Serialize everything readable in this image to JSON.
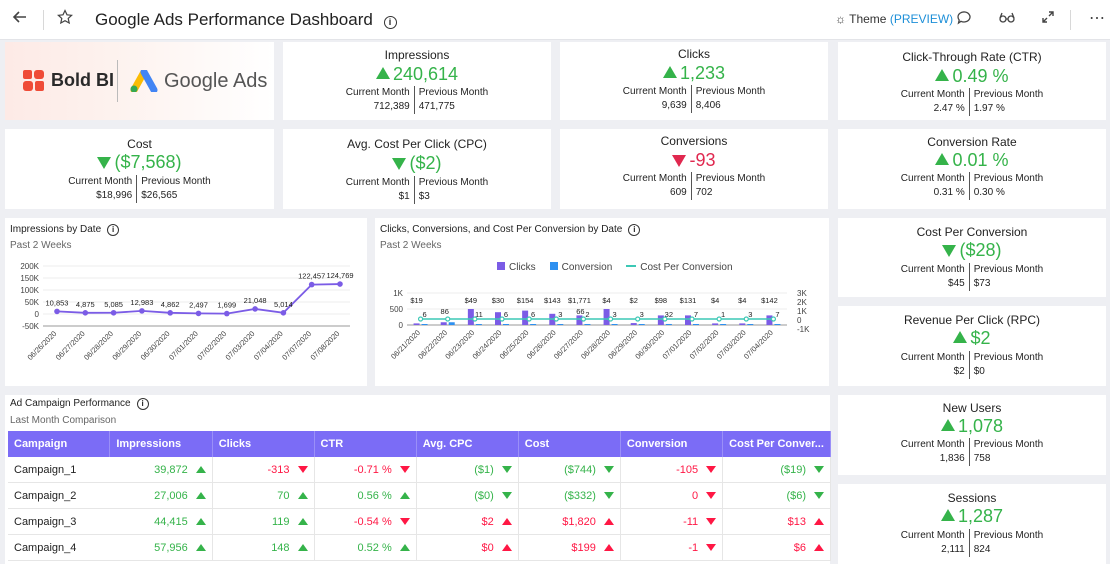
{
  "header": {
    "title": "Google Ads Performance Dashboard",
    "theme_label": "Theme",
    "theme_preview": "(PREVIEW)"
  },
  "logos": {
    "boldbi": "Bold BI",
    "googleads": "Google Ads"
  },
  "kpis": {
    "impressions": {
      "title": "Impressions",
      "value": "240,614",
      "trend": "up",
      "cur_label": "Current Month",
      "cur": "712,389",
      "prev_label": "Previous Month",
      "prev": "471,775"
    },
    "clicks": {
      "title": "Clicks",
      "value": "1,233",
      "trend": "up",
      "cur_label": "Current Month",
      "cur": "9,639",
      "prev_label": "Previous Month",
      "prev": "8,406"
    },
    "ctr": {
      "title": "Click-Through Rate (CTR)",
      "value": "0.49 %",
      "trend": "up",
      "cur_label": "Current Month",
      "cur": "2.47 %",
      "prev_label": "Previous Month",
      "prev": "1.97 %"
    },
    "cost": {
      "title": "Cost",
      "value": "($7,568)",
      "trend": "down-good",
      "cur_label": "Current Month",
      "cur": "$18,996",
      "prev_label": "Previous Month",
      "prev": "$26,565"
    },
    "cpc": {
      "title": "Avg. Cost Per Click (CPC)",
      "value": "($2)",
      "trend": "down-good",
      "cur_label": "Current Month",
      "cur": "$1",
      "prev_label": "Previous Month",
      "prev": "$3"
    },
    "conversions": {
      "title": "Conversions",
      "value": "-93",
      "trend": "down-bad",
      "cur_label": "Current Month",
      "cur": "609",
      "prev_label": "Previous Month",
      "prev": "702"
    },
    "conv_rate": {
      "title": "Conversion Rate",
      "value": "0.01 %",
      "trend": "up",
      "cur_label": "Current Month",
      "cur": "0.31 %",
      "prev_label": "Previous Month",
      "prev": "0.30 %"
    },
    "cost_per_conv": {
      "title": "Cost Per Conversion",
      "value": "($28)",
      "trend": "down-good",
      "cur_label": "Current Month",
      "cur": "$45",
      "prev_label": "Previous Month",
      "prev": "$73"
    },
    "rpc": {
      "title": "Revenue Per Click (RPC)",
      "value": "$2",
      "trend": "up",
      "cur_label": "Current Month",
      "cur": "$2",
      "prev_label": "Previous Month",
      "prev": "$0"
    },
    "new_users": {
      "title": "New Users",
      "value": "1,078",
      "trend": "up",
      "cur_label": "Current Month",
      "cur": "1,836",
      "prev_label": "Previous Month",
      "prev": "758"
    },
    "sessions": {
      "title": "Sessions",
      "value": "1,287",
      "trend": "up",
      "cur_label": "Current Month",
      "cur": "2,111",
      "prev_label": "Previous Month",
      "prev": "824"
    }
  },
  "impressions_chart": {
    "title": "Impressions by Date",
    "subtitle": "Past 2 Weeks"
  },
  "clicks_chart": {
    "title": "Clicks, Conversions, and Cost Per Conversion by Date",
    "subtitle": "Past 2 Weeks",
    "legend": [
      "Clicks",
      "Conversion",
      "Cost Per Conversion"
    ]
  },
  "campaign": {
    "title": "Ad Campaign Performance",
    "subtitle": "Last Month Comparison",
    "columns": [
      "Campaign",
      "Impressions",
      "Clicks",
      "CTR",
      "Avg. CPC",
      "Cost",
      "Conversion",
      "Cost Per Conver..."
    ],
    "rows": [
      {
        "name": "Campaign_1",
        "cells": [
          {
            "v": "39,872",
            "c": "up",
            "a": "up"
          },
          {
            "v": "-313",
            "c": "neg",
            "a": "down-r"
          },
          {
            "v": "-0.71 %",
            "c": "neg",
            "a": "down-r"
          },
          {
            "v": "($1)",
            "c": "up",
            "a": "down-g"
          },
          {
            "v": "($744)",
            "c": "up",
            "a": "down-g"
          },
          {
            "v": "-105",
            "c": "neg",
            "a": "down-r"
          },
          {
            "v": "($19)",
            "c": "up",
            "a": "down-g"
          }
        ]
      },
      {
        "name": "Campaign_2",
        "cells": [
          {
            "v": "27,006",
            "c": "up",
            "a": "up"
          },
          {
            "v": "70",
            "c": "up",
            "a": "up"
          },
          {
            "v": "0.56 %",
            "c": "up",
            "a": "up"
          },
          {
            "v": "($0)",
            "c": "up",
            "a": "down-g"
          },
          {
            "v": "($332)",
            "c": "up",
            "a": "down-g"
          },
          {
            "v": "0",
            "c": "neg",
            "a": "down-r"
          },
          {
            "v": "($6)",
            "c": "up",
            "a": "down-g"
          }
        ]
      },
      {
        "name": "Campaign_3",
        "cells": [
          {
            "v": "44,415",
            "c": "up",
            "a": "up"
          },
          {
            "v": "119",
            "c": "up",
            "a": "up"
          },
          {
            "v": "-0.54 %",
            "c": "neg",
            "a": "down-r"
          },
          {
            "v": "$2",
            "c": "neg",
            "a": "up-r"
          },
          {
            "v": "$1,820",
            "c": "neg",
            "a": "up-r"
          },
          {
            "v": "-11",
            "c": "neg",
            "a": "down-r"
          },
          {
            "v": "$13",
            "c": "neg",
            "a": "up-r"
          }
        ]
      },
      {
        "name": "Campaign_4",
        "cells": [
          {
            "v": "57,956",
            "c": "up",
            "a": "up"
          },
          {
            "v": "148",
            "c": "up",
            "a": "up"
          },
          {
            "v": "0.52 %",
            "c": "up",
            "a": "up"
          },
          {
            "v": "$0",
            "c": "neg",
            "a": "up-r"
          },
          {
            "v": "$199",
            "c": "neg",
            "a": "up-r"
          },
          {
            "v": "-1",
            "c": "neg",
            "a": "down-r"
          },
          {
            "v": "$6",
            "c": "neg",
            "a": "up-r"
          }
        ]
      }
    ]
  },
  "chart_data": [
    {
      "type": "line",
      "x": [
        "06/26/2020",
        "06/27/2020",
        "06/28/2020",
        "06/29/2020",
        "06/30/2020",
        "07/01/2020",
        "07/02/2020",
        "07/03/2020",
        "07/04/2020",
        "07/07/2020",
        "07/08/2020"
      ],
      "series": [
        {
          "values": [
            10853,
            4875,
            5085,
            12983,
            4862,
            2497,
            1699,
            21048,
            5014,
            122457,
            124769
          ]
        }
      ],
      "data_labels": [
        "10,853",
        "4,875",
        "5,085",
        "12,983",
        "4,862",
        "2,497",
        "1,699",
        "21,048",
        "5,014",
        "122,457",
        "124,769"
      ],
      "y_ticks": [
        "200K",
        "150K",
        "100K",
        "50K",
        "0",
        "-50K"
      ],
      "ylim": [
        -50000,
        200000
      ],
      "color": "#7b5ce6"
    },
    {
      "type": "bar",
      "x": [
        "06/21/2020",
        "06/22/2020",
        "06/23/2020",
        "06/24/2020",
        "06/25/2020",
        "06/26/2020",
        "06/27/2020",
        "06/28/2020",
        "06/29/2020",
        "06/30/2020",
        "07/01/2020",
        "07/02/2020",
        "07/03/2020",
        "07/04/2020"
      ],
      "series": [
        {
          "name": "Clicks",
          "values": [
            50,
            86,
            500,
            400,
            450,
            350,
            300,
            500,
            60,
            300,
            300,
            50,
            50,
            300
          ]
        },
        {
          "name": "Conversion",
          "values": [
            6,
            86,
            11,
            6,
            6,
            3,
            2,
            3,
            3,
            32,
            7,
            1,
            3,
            7
          ]
        },
        {
          "name": "Cost Per Conversion",
          "values": [
            19,
            2,
            49,
            30,
            154,
            143,
            1771,
            4,
            2,
            98,
            131,
            4,
            4,
            142
          ]
        }
      ],
      "clicks_labels": [
        "",
        "86",
        "",
        "",
        "",
        "",
        "66",
        "",
        "",
        "",
        "",
        "",
        "",
        ""
      ],
      "conversion_labels": [
        "6",
        "",
        "11",
        "6",
        "6",
        "3",
        "2",
        "3",
        "3",
        "32",
        "7",
        "1",
        "3",
        "7"
      ],
      "cpc_labels": [
        "$19",
        "",
        "$49",
        "$30",
        "$154",
        "$143",
        "$1,771",
        "$4",
        "$2",
        "$98",
        "$131",
        "$4",
        "$4",
        "$142"
      ],
      "y_ticks_left": [
        "1K",
        "500",
        "0"
      ],
      "y_ticks_right": [
        "3K",
        "2K",
        "1K",
        "0",
        "-1K"
      ],
      "colors": {
        "clicks": "#7b5ce6",
        "conversion": "#2e90f0",
        "cost_per_conversion": "#3cc8b5"
      }
    }
  ]
}
